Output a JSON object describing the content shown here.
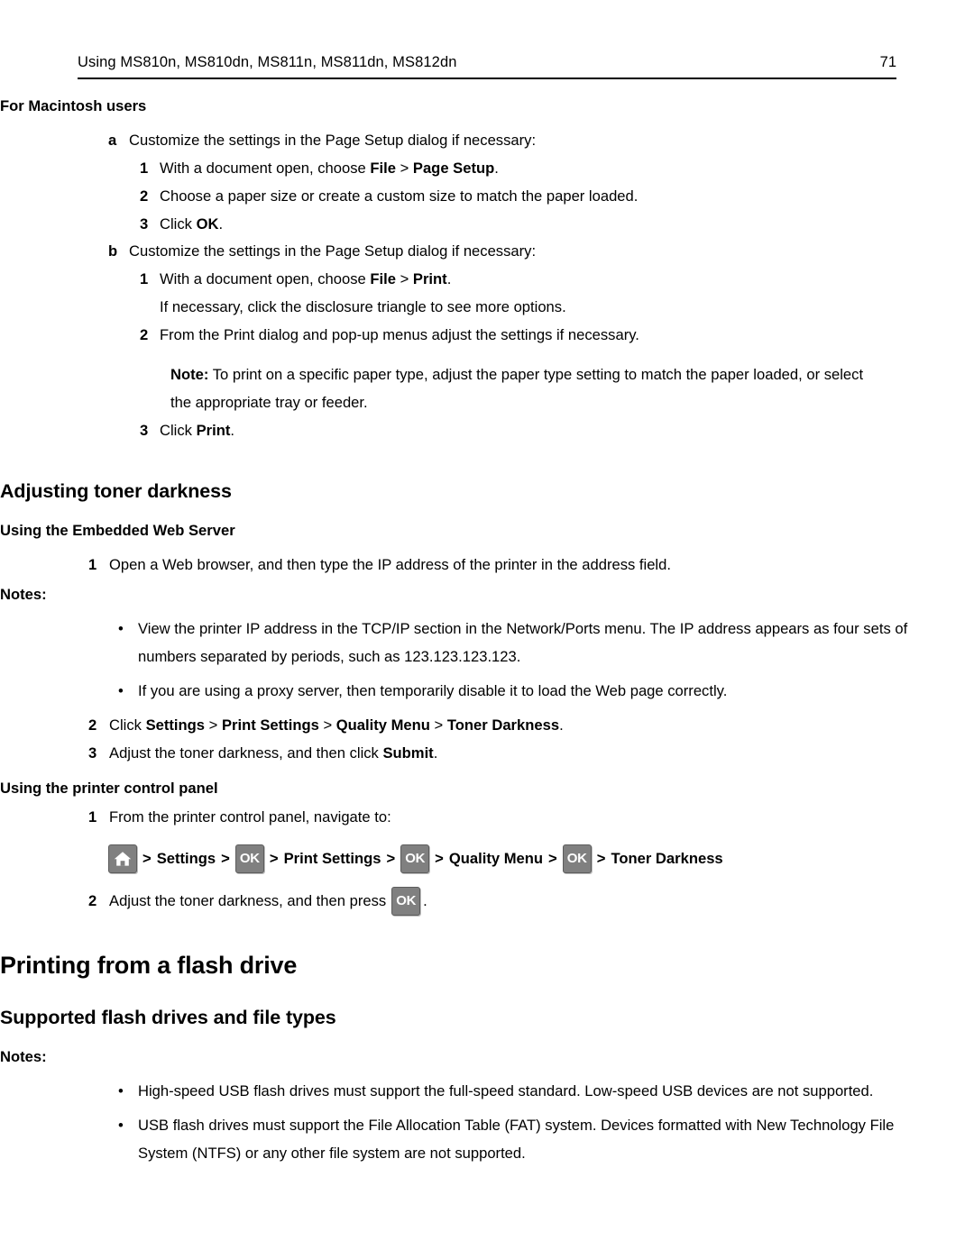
{
  "header": {
    "title": "Using MS810n, MS810dn, MS811n, MS811dn, MS812dn",
    "page_number": "71"
  },
  "colors": {
    "text": "#000000",
    "background": "#ffffff",
    "rule": "#000000",
    "button_fill": "#808080",
    "button_border": "#5c5c5c",
    "button_glyph": "#ffffff"
  },
  "macintosh_section": {
    "heading": "For Macintosh users",
    "item_a": {
      "marker": "a",
      "text": "Customize the settings in the Page Setup dialog if necessary:",
      "steps": [
        {
          "marker": "1",
          "pre": "With a document open, choose ",
          "bold1": "File",
          "mid": " > ",
          "bold2": "Page Setup",
          "post": "."
        },
        {
          "marker": "2",
          "pre": "Choose a paper size or create a custom size to match the paper loaded.",
          "bold1": "",
          "mid": "",
          "bold2": "",
          "post": ""
        },
        {
          "marker": "3",
          "pre": "Click ",
          "bold1": "OK",
          "mid": "",
          "bold2": "",
          "post": "."
        }
      ]
    },
    "item_b": {
      "marker": "b",
      "text": "Customize the settings in the Page Setup dialog if necessary:",
      "step1": {
        "marker": "1",
        "pre": "With a document open, choose ",
        "bold1": "File",
        "mid": " > ",
        "bold2": "Print",
        "post": "."
      },
      "step1_extra": "If necessary, click the disclosure triangle to see more options.",
      "step2": {
        "marker": "2",
        "text": "From the Print dialog and pop-up menus adjust the settings if necessary."
      },
      "note": {
        "label": "Note:",
        "text": " To print on a specific paper type, adjust the paper type setting to match the paper loaded, or select the appropriate tray or feeder."
      },
      "step3": {
        "marker": "3",
        "pre": "Click ",
        "bold1": "Print",
        "post": "."
      }
    }
  },
  "toner_section": {
    "title": "Adjusting toner darkness",
    "ews": {
      "subtitle": "Using the Embedded Web Server",
      "step1": {
        "marker": "1",
        "text": "Open a Web browser, and then type the IP address of the printer in the address field."
      },
      "notes_label": "Notes:",
      "bullets": [
        "View the printer IP address in the TCP/IP section in the Network/Ports menu. The IP address appears as four sets of numbers separated by periods, such as 123.123.123.123.",
        "If you are using a proxy server, then temporarily disable it to load the Web page correctly."
      ],
      "step2": {
        "marker": "2",
        "pre": "Click ",
        "b1": "Settings",
        "s1": " > ",
        "b2": "Print Settings",
        "s2": " > ",
        "b3": "Quality Menu",
        "s3": " > ",
        "b4": "Toner Darkness",
        "post": "."
      },
      "step3": {
        "marker": "3",
        "pre": "Adjust the toner darkness, and then click ",
        "bold1": "Submit",
        "post": "."
      }
    },
    "control_panel": {
      "subtitle": "Using the printer control panel",
      "step1": {
        "marker": "1",
        "text": "From the printer control panel, navigate to:"
      },
      "nav_path": {
        "home_icon": "home-icon",
        "sep": ">",
        "items": [
          "Settings",
          "Print Settings",
          "Quality Menu",
          "Toner Darkness"
        ],
        "ok_label": "OK"
      },
      "step2": {
        "marker": "2",
        "pre": "Adjust the toner darkness, and then press ",
        "ok_label": "OK",
        "post": "."
      }
    }
  },
  "flash_drive_section": {
    "title": "Printing from a flash drive",
    "subtitle": "Supported flash drives and file types",
    "notes_label": "Notes:",
    "bullets": [
      "High-speed USB flash drives must support the full-speed standard. Low-speed USB devices are not supported.",
      "USB flash drives must support the File Allocation Table (FAT) system. Devices formatted with New Technology File System (NTFS) or any other file system are not supported."
    ]
  }
}
